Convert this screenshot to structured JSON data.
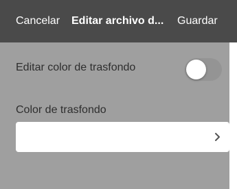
{
  "navbar": {
    "cancel_label": "Cancelar",
    "title": "Editar archivo d...",
    "save_label": "Guardar"
  },
  "settings": {
    "background_toggle": {
      "label": "Editar color de trasfondo",
      "enabled": false
    },
    "background_color": {
      "label": "Color de trasfondo",
      "value": ""
    }
  },
  "icons": {
    "picker": "chevron-right-icon"
  },
  "colors": {
    "navbar_bg": "#4a4a4a",
    "screen_bg": "#9f9f9f",
    "toggle_off": "#949494",
    "text": "#2e2e2e"
  }
}
